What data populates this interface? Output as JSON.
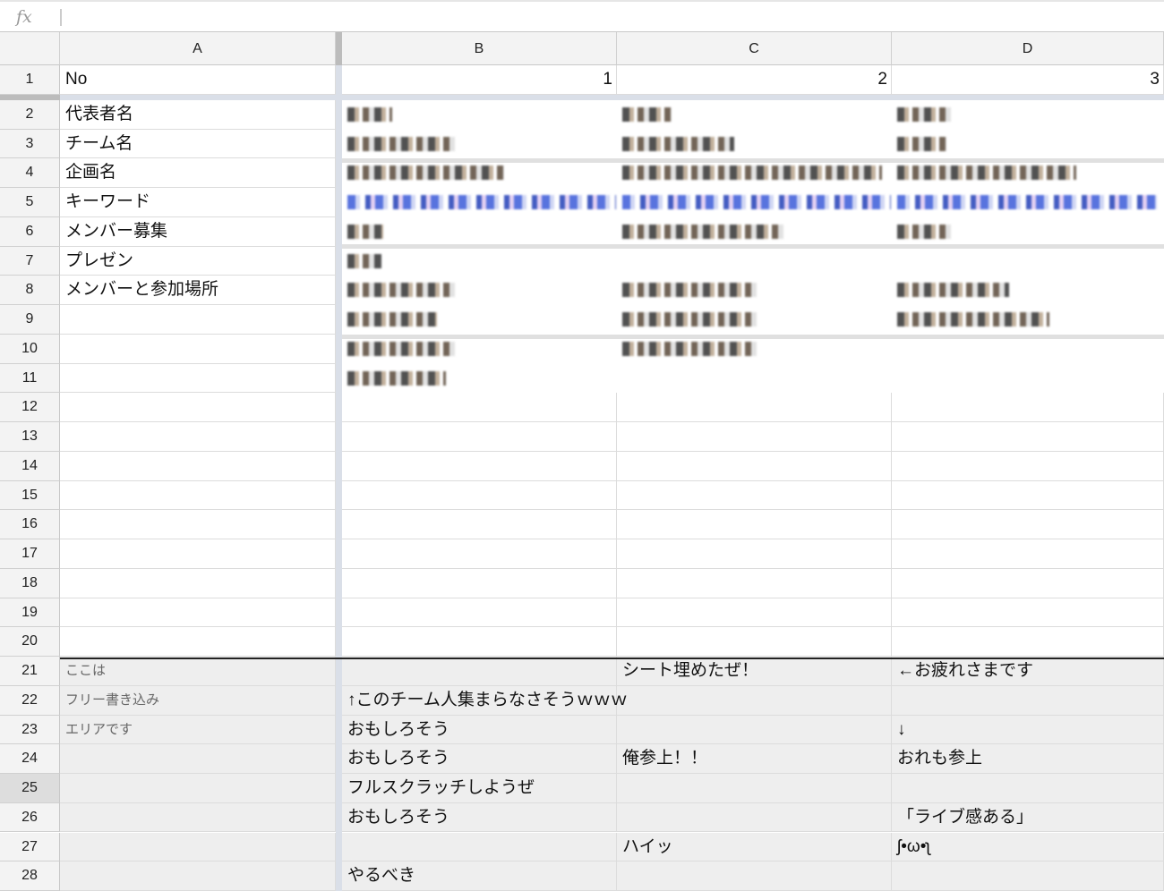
{
  "formula_bar": {
    "icon": "fx-icon",
    "label": "fx",
    "value": ""
  },
  "columns": [
    "A",
    "B",
    "C",
    "D"
  ],
  "rows": [
    {
      "n": "1",
      "A": "No",
      "B": "1",
      "C": "2",
      "D": "3"
    },
    {
      "n": "2",
      "A": "代表者名"
    },
    {
      "n": "3",
      "A": "チーム名"
    },
    {
      "n": "4",
      "A": "企画名"
    },
    {
      "n": "5",
      "A": "キーワード"
    },
    {
      "n": "6",
      "A": "メンバー募集"
    },
    {
      "n": "7",
      "A": "プレゼン"
    },
    {
      "n": "8",
      "A": "メンバーと参加場所"
    },
    {
      "n": "9"
    },
    {
      "n": "10"
    },
    {
      "n": "11"
    },
    {
      "n": "12"
    },
    {
      "n": "13"
    },
    {
      "n": "14"
    },
    {
      "n": "15"
    },
    {
      "n": "16"
    },
    {
      "n": "17"
    },
    {
      "n": "18"
    },
    {
      "n": "19"
    },
    {
      "n": "20"
    },
    {
      "n": "21",
      "A": "ここは",
      "C": "シート埋めたぜ！",
      "D": "←お疲れさまです"
    },
    {
      "n": "22",
      "A": "フリー書き込み",
      "B": "↑このチーム人集まらなさそうｗｗｗ"
    },
    {
      "n": "23",
      "A": "エリアです",
      "B": "おもしろそう",
      "D": "↓"
    },
    {
      "n": "24",
      "B": "おもしろそう",
      "C": "俺参上！！",
      "D": "おれも参上"
    },
    {
      "n": "25",
      "B": "フルスクラッチしようぜ"
    },
    {
      "n": "26",
      "B": "おもしろそう",
      "D": "「ライブ感ある」"
    },
    {
      "n": "27",
      "C": "ハイッ",
      "D": "ʃ•ω•ʅ"
    },
    {
      "n": "28",
      "B": "やるべき"
    }
  ],
  "selected_row": "25"
}
